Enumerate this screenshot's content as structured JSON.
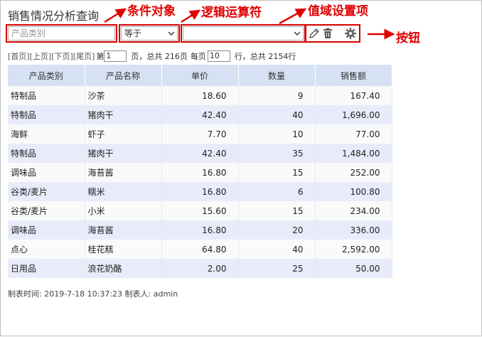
{
  "page_title": "销售情况分析查询",
  "annotations": {
    "condition_object": "条件对象",
    "logic_operator": "逻辑运算符",
    "value_field": "值域设置项",
    "buttons": "按钮"
  },
  "query": {
    "field_placeholder": "产品类别",
    "operator_value": "等于",
    "value_selected": ""
  },
  "icons": {
    "edit": "pencil-icon",
    "delete": "trash-icon",
    "settings": "gear-icon"
  },
  "pager": {
    "first": "[首页]",
    "prev": "[上页]",
    "next": "[下页]",
    "last": "[尾页]",
    "page_prefix": "第",
    "current_page": "1",
    "total_pages_text": "页，总共 216页",
    "per_page_label": "每页",
    "per_page_value": "10",
    "total_rows_text": "行，总共 2154行"
  },
  "table": {
    "headers": [
      "产品类别",
      "产品名称",
      "单价",
      "数量",
      "销售额"
    ],
    "rows": [
      [
        "特制品",
        "沙茶",
        "18.60",
        "9",
        "167.40"
      ],
      [
        "特制品",
        "猪肉干",
        "42.40",
        "40",
        "1,696.00"
      ],
      [
        "海鲜",
        "虾子",
        "7.70",
        "10",
        "77.00"
      ],
      [
        "特制品",
        "猪肉干",
        "42.40",
        "35",
        "1,484.00"
      ],
      [
        "调味品",
        "海苔酱",
        "16.80",
        "15",
        "252.00"
      ],
      [
        "谷类/麦片",
        "糯米",
        "16.80",
        "6",
        "100.80"
      ],
      [
        "谷类/麦片",
        "小米",
        "15.60",
        "15",
        "234.00"
      ],
      [
        "调味品",
        "海苔酱",
        "16.80",
        "20",
        "336.00"
      ],
      [
        "点心",
        "桂花糕",
        "64.80",
        "40",
        "2,592.00"
      ],
      [
        "日用品",
        "浪花奶酪",
        "2.00",
        "25",
        "50.00"
      ]
    ]
  },
  "footer": "制表时间: 2019-7-18 10:37:23 制表人: admin",
  "colors": {
    "annotation_red": "#e00000",
    "header_blue": "#d6e2f3",
    "row_even": "#e8ecfa"
  }
}
